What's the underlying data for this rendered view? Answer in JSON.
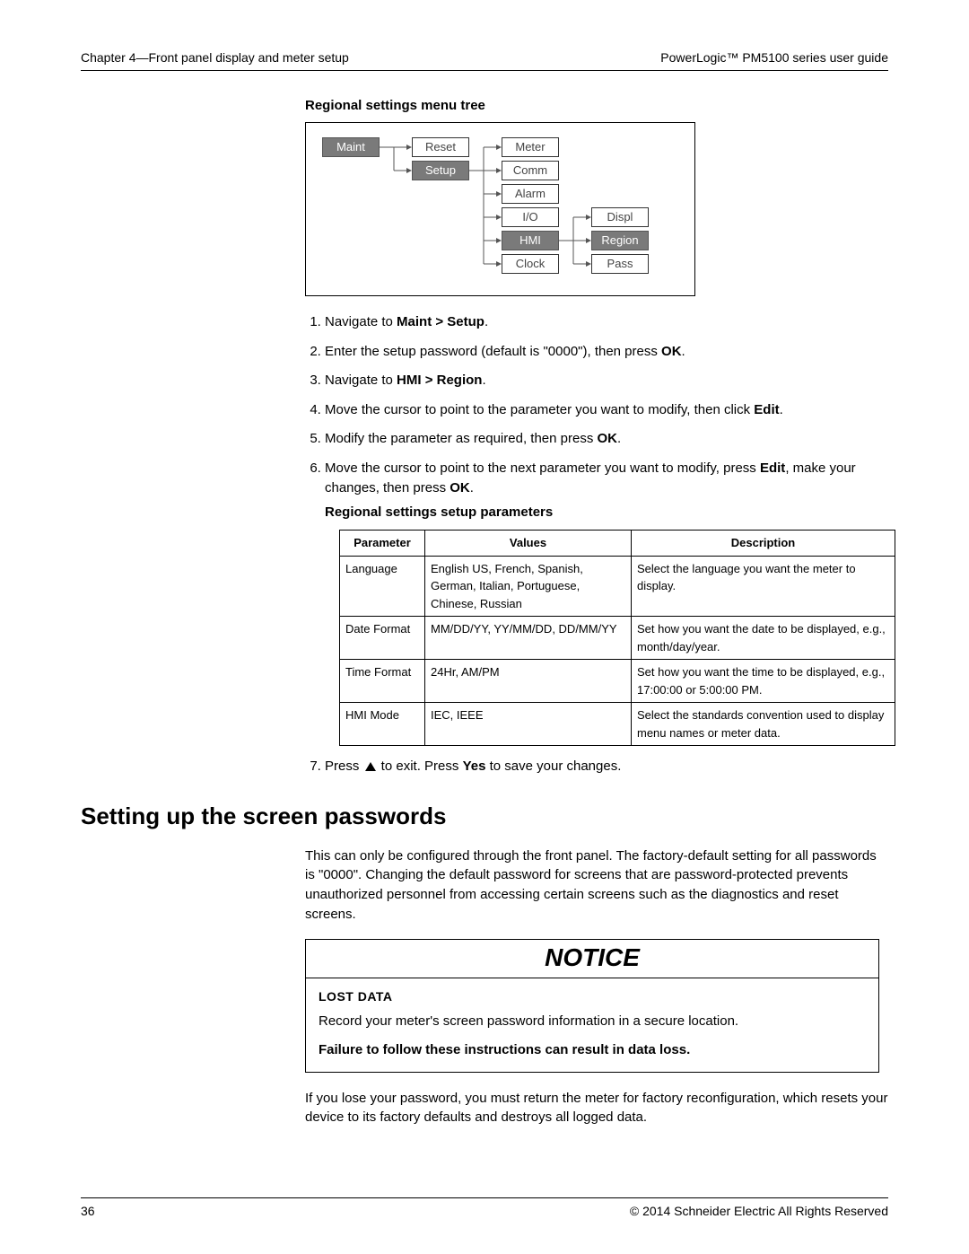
{
  "header": {
    "left": "Chapter 4—Front panel display and meter setup",
    "right": "PowerLogic™  PM5100 series user guide"
  },
  "tree": {
    "heading": "Regional settings menu tree",
    "nodes": {
      "maint": "Maint",
      "reset": "Reset",
      "setup": "Setup",
      "meter": "Meter",
      "comm": "Comm",
      "alarm": "Alarm",
      "io": "I/O",
      "hmi": "HMI",
      "clock": "Clock",
      "displ": "Displ",
      "region": "Region",
      "pass": "Pass"
    }
  },
  "steps": {
    "s1_a": "Navigate to ",
    "s1_b": "Maint > Setup",
    "s1_c": ".",
    "s2_a": "Enter the setup password (default is \"0000\"), then press ",
    "s2_b": "OK",
    "s2_c": ".",
    "s3_a": "Navigate to ",
    "s3_b": "HMI > Region",
    "s3_c": ".",
    "s4_a": "Move the cursor to point to the parameter you want to modify, then click ",
    "s4_b": "Edit",
    "s4_c": ".",
    "s5_a": "Modify the parameter as required, then press ",
    "s5_b": "OK",
    "s5_c": ".",
    "s6_a": "Move the cursor to point to the next parameter you want to modify, press ",
    "s6_b": "Edit",
    "s6_c": ", make your changes, then press ",
    "s6_d": "OK",
    "s6_e": ".",
    "params_heading": "Regional settings setup parameters",
    "s7_a": "Press ",
    "s7_b": " to exit. Press ",
    "s7_c": "Yes",
    "s7_d": " to save your changes."
  },
  "table": {
    "headers": {
      "p": "Parameter",
      "v": "Values",
      "d": "Description"
    },
    "rows": [
      {
        "p": "Language",
        "v": "English US, French, Spanish, German, Italian, Portuguese, Chinese, Russian",
        "d": "Select the language you want the meter to display."
      },
      {
        "p": "Date Format",
        "v": "MM/DD/YY, YY/MM/DD, DD/MM/YY",
        "d": "Set how you want the date to be displayed, e.g., month/day/year."
      },
      {
        "p": "Time Format",
        "v": "24Hr, AM/PM",
        "d": "Set how you want the time to be displayed, e.g., 17:00:00 or 5:00:00 PM."
      },
      {
        "p": "HMI Mode",
        "v": "IEC, IEEE",
        "d": "Select the standards convention used to display menu names or meter data."
      }
    ]
  },
  "section2": {
    "title": "Setting up the screen passwords",
    "intro": "This can only be configured through the front panel. The factory-default setting for all passwords is \"0000\". Changing the default password for screens that are password-protected prevents unauthorized personnel from accessing certain screens such as the diagnostics and reset screens.",
    "notice": {
      "title": "NOTICE",
      "sub": "Lost Data",
      "line": "Record your meter's screen password information in a secure location.",
      "warn": "Failure to follow these instructions can result in data loss."
    },
    "after": "If you lose your password, you must return the meter for factory reconfiguration, which resets your device to its factory defaults and destroys all logged data."
  },
  "footer": {
    "page": "36",
    "copyright": "© 2014 Schneider Electric All Rights Reserved"
  }
}
